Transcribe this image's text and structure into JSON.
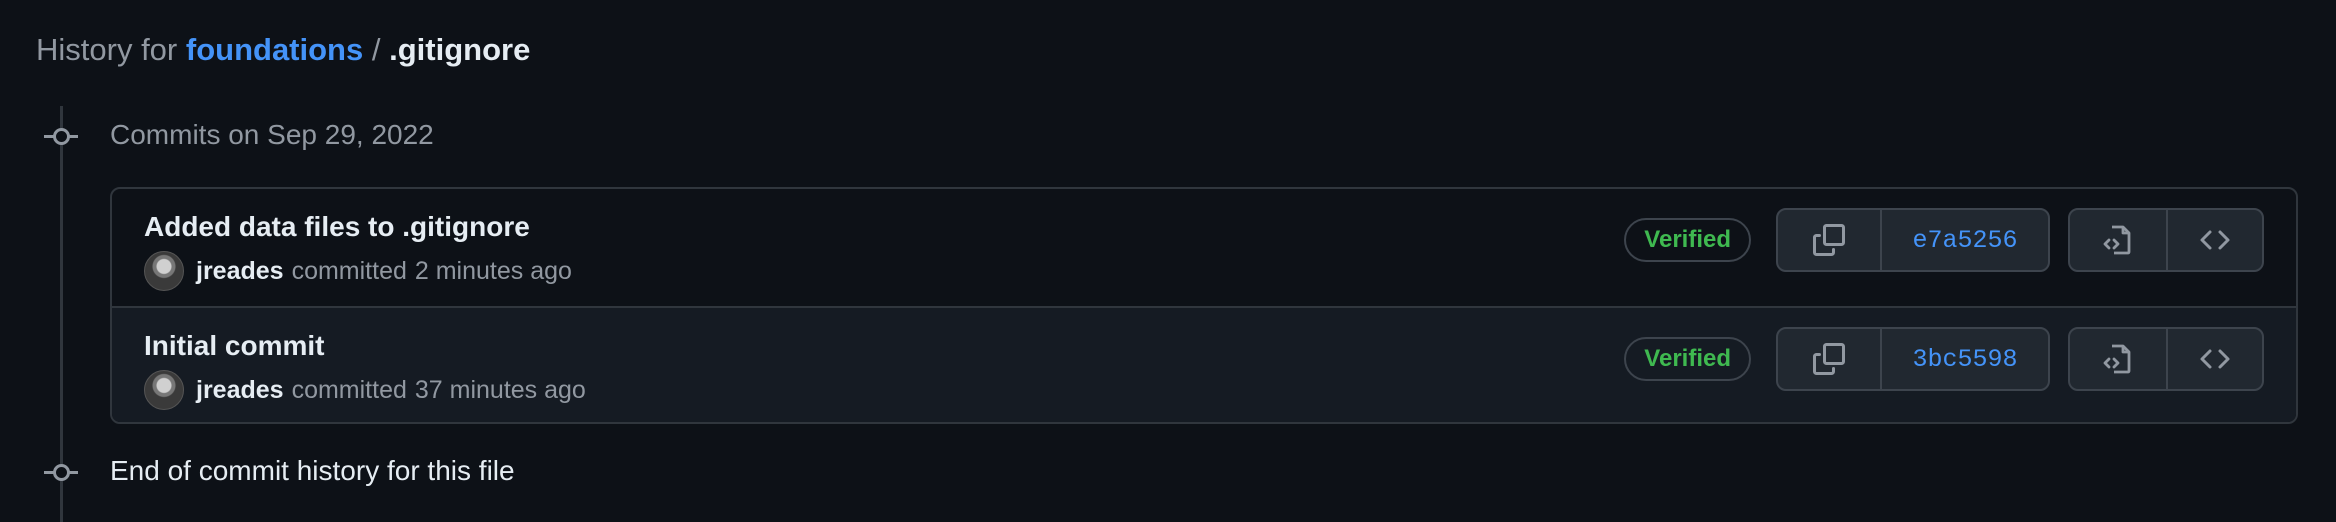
{
  "header": {
    "prefix": "History for",
    "repo": "foundations",
    "separator": "/",
    "file": ".gitignore"
  },
  "group": {
    "title": "Commits on Sep 29, 2022"
  },
  "commits": [
    {
      "title": "Added data files to .gitignore",
      "author": "jreades",
      "action": "committed",
      "time": "2 minutes ago",
      "badge": "Verified",
      "sha": "e7a5256"
    },
    {
      "title": "Initial commit",
      "author": "jreades",
      "action": "committed",
      "time": "37 minutes ago",
      "badge": "Verified",
      "sha": "3bc5598"
    }
  ],
  "footer": {
    "end_text": "End of commit history for this file"
  },
  "icons": {
    "copy": "copy-icon",
    "browse_file": "file-code-icon",
    "browse_repo": "code-icon",
    "timeline": "git-commit-icon"
  },
  "colors": {
    "background": "#0d1117",
    "link": "#4493f8",
    "verified": "#3fb950",
    "muted": "#9198a1",
    "border": "#30363d"
  }
}
